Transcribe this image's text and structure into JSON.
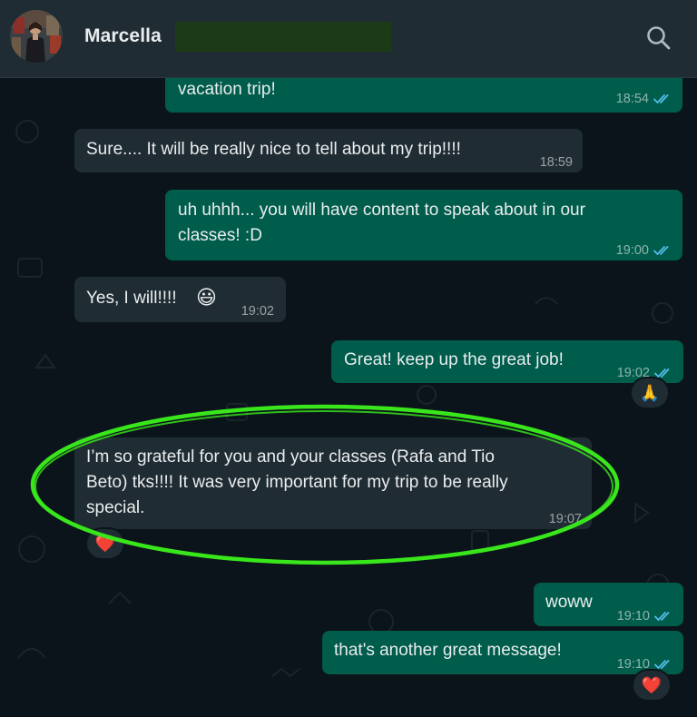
{
  "header": {
    "contact_name": "Marcella",
    "avatar_icon": "contact-avatar",
    "search_icon": "search-icon"
  },
  "messages": [
    {
      "id": "m1",
      "direction": "outgoing",
      "text": "vacation trip!",
      "time": "18:54",
      "status": "read"
    },
    {
      "id": "m2",
      "direction": "incoming",
      "text": "Sure.... It will be really nice to tell about my trip!!!!",
      "time": "18:59"
    },
    {
      "id": "m3",
      "direction": "outgoing",
      "lines": [
        "uh uhhh... you will have content to speak about in our",
        "classes! :D"
      ],
      "time": "19:00",
      "status": "read"
    },
    {
      "id": "m4",
      "direction": "incoming",
      "text": "Yes, I will!!!!",
      "emoji": "😃",
      "time": "19:02"
    },
    {
      "id": "m5",
      "direction": "outgoing",
      "text": "Great! keep up the great job!",
      "time": "19:02",
      "status": "read",
      "reaction": "🙏"
    },
    {
      "id": "m6",
      "direction": "incoming",
      "lines": [
        "I’m so grateful for you and your classes (Rafa and Tio",
        "Beto) tks!!!! It was very important for my trip to be really",
        "special."
      ],
      "time": "19:07",
      "reaction": "❤️",
      "highlighted": true
    },
    {
      "id": "m7",
      "direction": "outgoing",
      "text": "woww",
      "time": "19:10",
      "status": "read"
    },
    {
      "id": "m8",
      "direction": "outgoing",
      "text": "that's another great message!",
      "time": "19:10",
      "status": "read",
      "reaction": "❤️"
    }
  ],
  "colors": {
    "background": "#0b141a",
    "header": "#202c33",
    "incoming_bubble": "#202c33",
    "outgoing_bubble": "#005c4b",
    "read_ticks": "#53bdeb",
    "highlight_circle": "#39e61c",
    "redaction": "#1d3a16"
  }
}
